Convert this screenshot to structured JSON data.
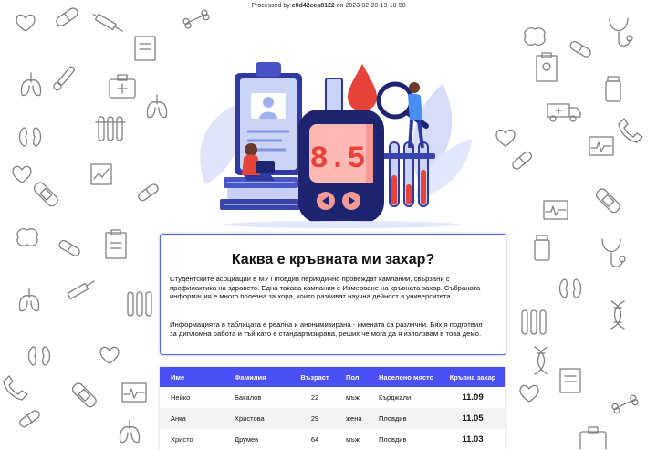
{
  "stamp": {
    "prefix": "Processed by",
    "id": "e0d42eea8122",
    "mid": "on",
    "date": "2023-02-20-13-10-58"
  },
  "hero": {
    "meter_reading": "8.5"
  },
  "card": {
    "title": "Каква е кръвната ми захар?",
    "paragraph1": "Студентските асоциации в МУ Пловдив периодично провеждат кампании, свързани с профилактика на здравето. Една такава кампания е Измерване на кръвната захар. Събраната информация е много полезна за хора, които развиват научна дейност в университета.",
    "paragraph2": "Информацията в таблицата е реална и анонимизирана - имената са различни. Бях я подготвил за дипломна работа и тъй като е стандартизирана, реших че мога да я използвам в това демо."
  },
  "table": {
    "headers": [
      "Име",
      "Фамилия",
      "Възраст",
      "Пол",
      "Населено място",
      "Кръвна захар"
    ],
    "rows": [
      [
        "Нейко",
        "Бакалов",
        "22",
        "мъж",
        "Кърджали",
        "11.09"
      ],
      [
        "Анка",
        "Христова",
        "29",
        "жена",
        "Пловдив",
        "11.05"
      ],
      [
        "Христо",
        "Друмев",
        "64",
        "мъж",
        "Пловдив",
        "11.03"
      ]
    ]
  },
  "colors": {
    "accent": "#4a4ff6",
    "card_border": "#4a66f2",
    "meter_red": "#e8433a"
  }
}
